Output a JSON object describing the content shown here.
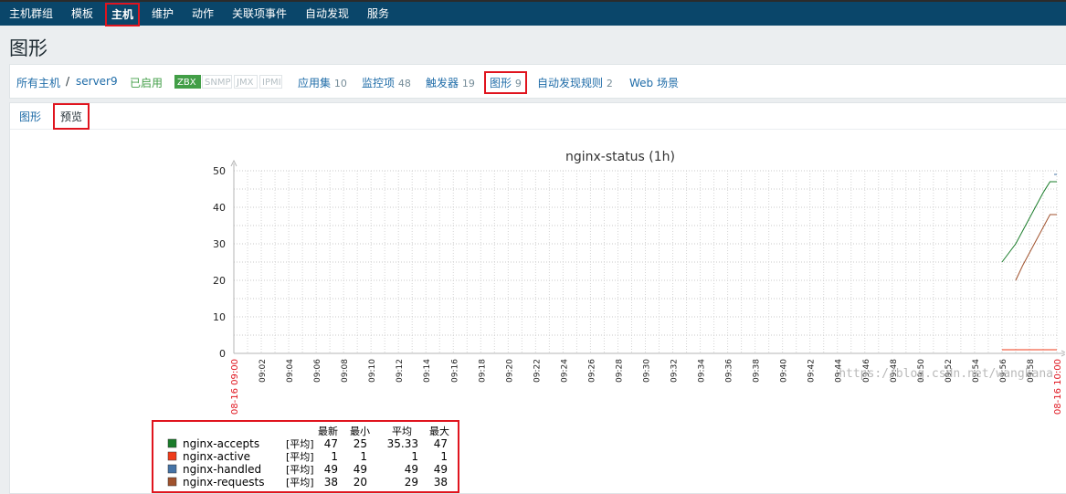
{
  "nav": {
    "items": [
      {
        "label": "主机群组",
        "active": false
      },
      {
        "label": "模板",
        "active": false
      },
      {
        "label": "主机",
        "active": true
      },
      {
        "label": "维护",
        "active": false
      },
      {
        "label": "动作",
        "active": false
      },
      {
        "label": "关联项事件",
        "active": false
      },
      {
        "label": "自动发现",
        "active": false
      },
      {
        "label": "服务",
        "active": false
      }
    ]
  },
  "page_title": "图形",
  "host_nav": {
    "all_hosts": "所有主机",
    "separator": "/",
    "host": "server9",
    "status": "已启用",
    "badges": [
      {
        "label": "ZBX",
        "on": true
      },
      {
        "label": "SNMP",
        "on": false
      },
      {
        "label": "JMX",
        "on": false
      },
      {
        "label": "IPMI",
        "on": false
      }
    ],
    "links": [
      {
        "label": "应用集",
        "count": "10"
      },
      {
        "label": "监控项",
        "count": "48"
      },
      {
        "label": "触发器",
        "count": "19"
      },
      {
        "label": "图形",
        "count": "9"
      },
      {
        "label": "自动发现规则",
        "count": "2"
      },
      {
        "label": "Web 场景",
        "count": ""
      }
    ]
  },
  "tabs": [
    {
      "label": "图形",
      "selected": false
    },
    {
      "label": "预览",
      "selected": true
    }
  ],
  "colors": {
    "accepts": "#1a7c2a",
    "active": "#ef3b1a",
    "handled": "#4573a6",
    "requests": "#a0522d",
    "time_label": "#e0141e"
  },
  "chart_data": {
    "type": "line",
    "title": "nginx-status (1h)",
    "ylim": [
      0,
      50
    ],
    "yticks": [
      0,
      10,
      20,
      30,
      40,
      50
    ],
    "x_start_label": "08-16 09:00",
    "x_end_label": "08-16 10:00",
    "xticks": [
      "09:02",
      "09:04",
      "09:06",
      "09:08",
      "09:10",
      "09:12",
      "09:14",
      "09:16",
      "09:18",
      "09:20",
      "09:22",
      "09:24",
      "09:26",
      "09:28",
      "09:30",
      "09:32",
      "09:34",
      "09:36",
      "09:38",
      "09:40",
      "09:42",
      "09:44",
      "09:46",
      "09:48",
      "09:50",
      "09:52",
      "09:54",
      "09:56",
      "09:58"
    ],
    "grid": true,
    "legend_headers": [
      "最新",
      "最小",
      "平均",
      "最大"
    ],
    "series": [
      {
        "name": "nginx-accepts",
        "color_key": "accepts",
        "unit": "[平均]",
        "last": "47",
        "min": "25",
        "avg": "35.33",
        "max": "47",
        "points": [
          [
            56.0,
            25
          ],
          [
            56.5,
            27.5
          ],
          [
            57.0,
            30
          ],
          [
            57.5,
            33.5
          ],
          [
            58.0,
            37
          ],
          [
            58.5,
            40.5
          ],
          [
            59.0,
            44
          ],
          [
            59.5,
            47
          ],
          [
            60.0,
            47
          ]
        ]
      },
      {
        "name": "nginx-active",
        "color_key": "active",
        "unit": "[平均]",
        "last": "1",
        "min": "1",
        "avg": "1",
        "max": "1",
        "points": [
          [
            56.0,
            1
          ],
          [
            57.0,
            1
          ],
          [
            58.0,
            1
          ],
          [
            59.0,
            1
          ],
          [
            60.0,
            1
          ]
        ]
      },
      {
        "name": "nginx-handled",
        "color_key": "handled",
        "unit": "[平均]",
        "last": "49",
        "min": "49",
        "avg": "49",
        "max": "49",
        "points": [
          [
            59.8,
            49
          ],
          [
            60.0,
            49
          ]
        ]
      },
      {
        "name": "nginx-requests",
        "color_key": "requests",
        "unit": "[平均]",
        "last": "38",
        "min": "20",
        "avg": "29",
        "max": "38",
        "points": [
          [
            57.0,
            20
          ],
          [
            57.5,
            24
          ],
          [
            58.0,
            27.5
          ],
          [
            58.5,
            31
          ],
          [
            59.0,
            34.5
          ],
          [
            59.5,
            38
          ],
          [
            60.0,
            38
          ]
        ]
      }
    ]
  },
  "watermark": "https://blog.csdn.net/wangkana"
}
